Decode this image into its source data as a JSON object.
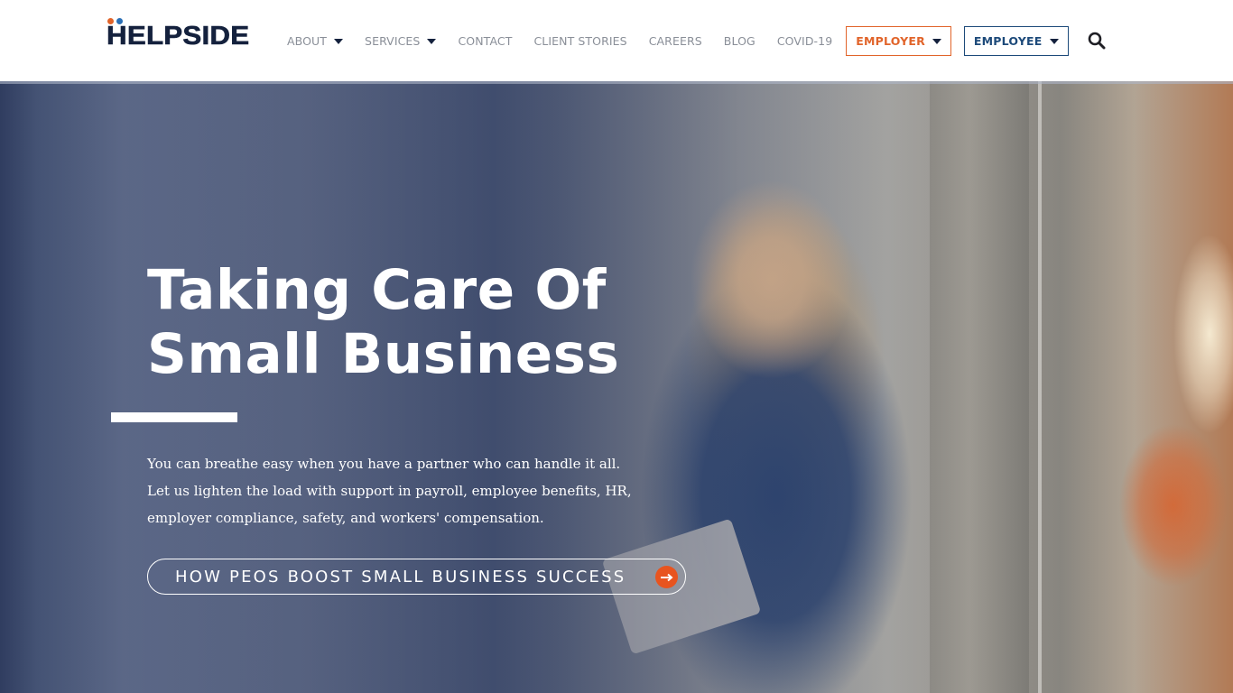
{
  "brand": {
    "name": "HELPSIDE",
    "colors": {
      "navy": "#14213d",
      "orange": "#e1642a",
      "blue": "#1d4a7a",
      "dot_orange": "#e1642a",
      "dot_blue": "#2a6fb6",
      "cta_arrow": "#e8541f"
    }
  },
  "nav": {
    "items": [
      {
        "label": "ABOUT",
        "has_dropdown": true
      },
      {
        "label": "SERVICES",
        "has_dropdown": true
      },
      {
        "label": "CONTACT",
        "has_dropdown": false
      },
      {
        "label": "CLIENT STORIES",
        "has_dropdown": false
      },
      {
        "label": "CAREERS",
        "has_dropdown": false
      },
      {
        "label": "BLOG",
        "has_dropdown": false
      },
      {
        "label": "COVID-19",
        "has_dropdown": false
      }
    ],
    "employer_button": "EMPLOYER",
    "employee_button": "EMPLOYEE",
    "search_icon": "search-icon",
    "caret_icon": "caret-down-icon"
  },
  "hero": {
    "headline_line1": "Taking Care Of",
    "headline_line2": "Small Business",
    "subtext": "You can breathe easy when you have a partner who can handle it all. Let us lighten the load with support in payroll, employee benefits, HR, employer compliance, safety, and workers' compensation.",
    "cta_label": "HOW PEOS BOOST SMALL BUSINESS SUCCESS",
    "cta_icon": "arrow-right-icon",
    "background": "photo of smiling woman holding tablet in office"
  }
}
